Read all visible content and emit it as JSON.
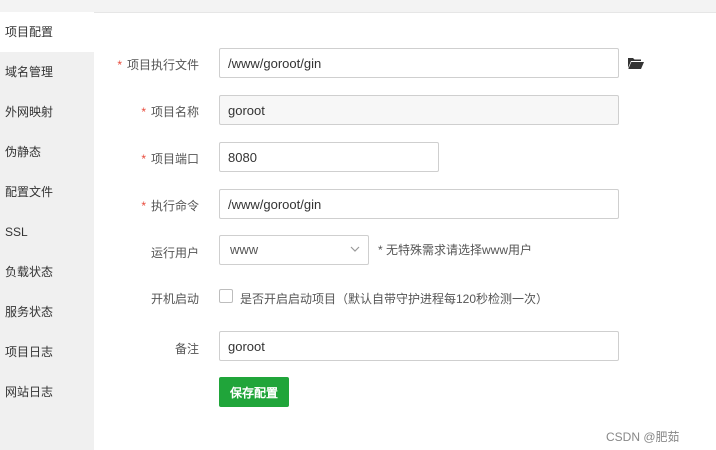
{
  "sidebar": {
    "items": [
      {
        "label": "项目配置",
        "active": true
      },
      {
        "label": "域名管理"
      },
      {
        "label": "外网映射"
      },
      {
        "label": "伪静态"
      },
      {
        "label": "配置文件"
      },
      {
        "label": "SSL"
      },
      {
        "label": "负载状态"
      },
      {
        "label": "服务状态"
      },
      {
        "label": "项目日志"
      },
      {
        "label": "网站日志"
      }
    ]
  },
  "form": {
    "required_mark": "*",
    "exec_file": {
      "label": "项目执行文件",
      "value": "/www/goroot/gin"
    },
    "project_name": {
      "label": "项目名称",
      "value": "goroot"
    },
    "project_port": {
      "label": "项目端口",
      "value": "8080"
    },
    "exec_command": {
      "label": "执行命令",
      "value": "/www/goroot/gin"
    },
    "run_user": {
      "label": "运行用户",
      "value": "www",
      "hint": "* 无特殊需求请选择www用户"
    },
    "autostart": {
      "label": "开机启动",
      "text": "是否开启启动项目（默认自带守护进程每120秒检测一次）",
      "checked": false
    },
    "remark": {
      "label": "备注",
      "value": "goroot"
    },
    "save_label": "保存配置"
  },
  "watermark": "CSDN @肥茹",
  "colors": {
    "accent": "#20a53a",
    "required": "#e84b3c",
    "sidebar_bg": "#f0f0f0"
  },
  "icons": {
    "folder": "folder-open-icon",
    "select": "chevron-down-icon"
  }
}
